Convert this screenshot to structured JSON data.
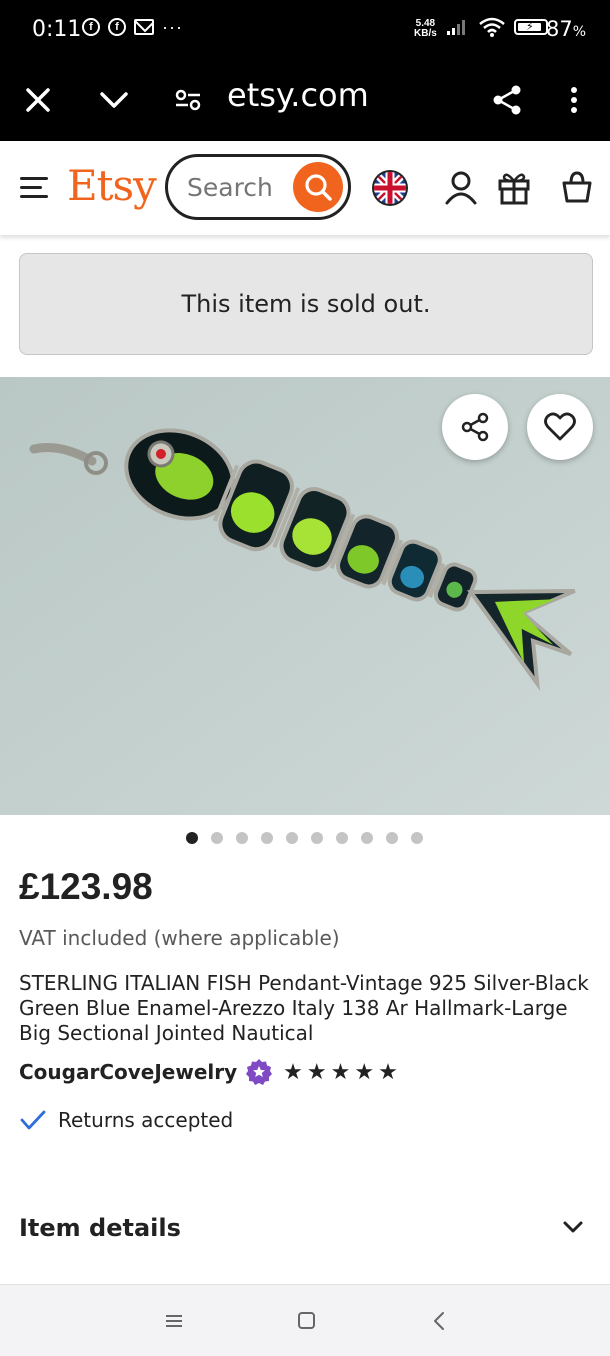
{
  "status_bar": {
    "time": "0:11",
    "notif_icons": [
      "facebook-icon",
      "facebook-icon",
      "gmail-icon"
    ],
    "more": "···",
    "net_speed_value": "5.48",
    "net_speed_unit": "KB/s",
    "battery_level": 0.87,
    "battery_percent": "87",
    "battery_unit": "%"
  },
  "browser": {
    "url": "etsy.com"
  },
  "header": {
    "logo": "Etsy",
    "search_placeholder": "Search",
    "accent_color": "#f1641e"
  },
  "notice": {
    "sold_out": "This item is sold out."
  },
  "gallery": {
    "image_count": 10,
    "active_index": 0
  },
  "product": {
    "price": "£123.98",
    "vat_note": "VAT included (where applicable)",
    "title": "STERLING ITALIAN FISH Pendant-Vintage 925 Silver-Black Green Blue Enamel-Arezzo Italy 138 Ar Hallmark-Large Big Sectional Jointed Nautical",
    "shop_name": "CougarCoveJewelry",
    "rating": 5,
    "returns": "Returns accepted"
  },
  "sections": {
    "item_details": "Item details"
  }
}
